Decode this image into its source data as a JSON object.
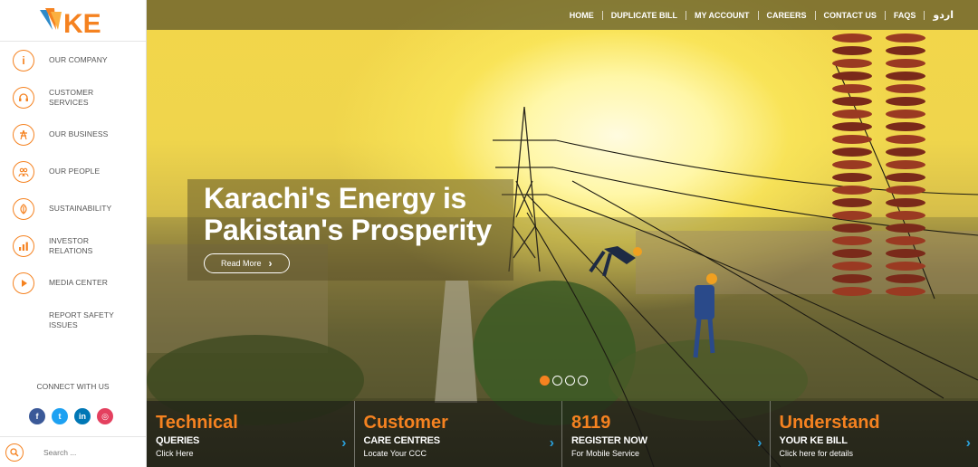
{
  "brand": {
    "logo_text": "KE"
  },
  "sidebar": {
    "items": [
      {
        "label": "OUR COMPANY",
        "icon": "info-icon"
      },
      {
        "label": "CUSTOMER SERVICES",
        "icon": "headset-icon"
      },
      {
        "label": "OUR BUSINESS",
        "icon": "tower-icon"
      },
      {
        "label": "OUR PEOPLE",
        "icon": "people-icon"
      },
      {
        "label": "SUSTAINABILITY",
        "icon": "leaf-icon"
      },
      {
        "label": "INVESTOR RELATIONS",
        "icon": "chart-icon"
      },
      {
        "label": "MEDIA CENTER",
        "icon": "play-icon"
      },
      {
        "label": "REPORT SAFETY ISSUES",
        "icon": ""
      }
    ],
    "connect_label": "CONNECT WITH US",
    "social": [
      {
        "name": "facebook",
        "glyph": "f",
        "color": "#3b5998"
      },
      {
        "name": "twitter",
        "glyph": "t",
        "color": "#1da1f2"
      },
      {
        "name": "linkedin",
        "glyph": "in",
        "color": "#0077b5"
      },
      {
        "name": "instagram",
        "glyph": "◎",
        "color": "#e4405f"
      }
    ],
    "search_placeholder": "Search ..."
  },
  "topnav": [
    "HOME",
    "DUPLICATE BILL",
    "MY ACCOUNT",
    "CAREERS",
    "CONTACT US",
    "FAQS",
    "اردو"
  ],
  "hero": {
    "headline_line1": "Karachi's Energy is",
    "headline_line2": "Pakistan's Prosperity",
    "read_more": "Read More",
    "slides": 4,
    "active_slide": 1
  },
  "cards": [
    {
      "title": "Technical",
      "subtitle": "QUERIES",
      "caption": "Click Here"
    },
    {
      "title": "Customer",
      "subtitle": "CARE CENTRES",
      "caption": "Locate Your CCC"
    },
    {
      "title": "8119",
      "subtitle": "REGISTER NOW",
      "caption": "For Mobile Service"
    },
    {
      "title": "Understand",
      "subtitle": "YOUR KE BILL",
      "caption": "Click here for details"
    }
  ],
  "colors": {
    "accent": "#f58220",
    "arrow": "#2a9fd8",
    "brand_blue": "#2e8bc9"
  }
}
